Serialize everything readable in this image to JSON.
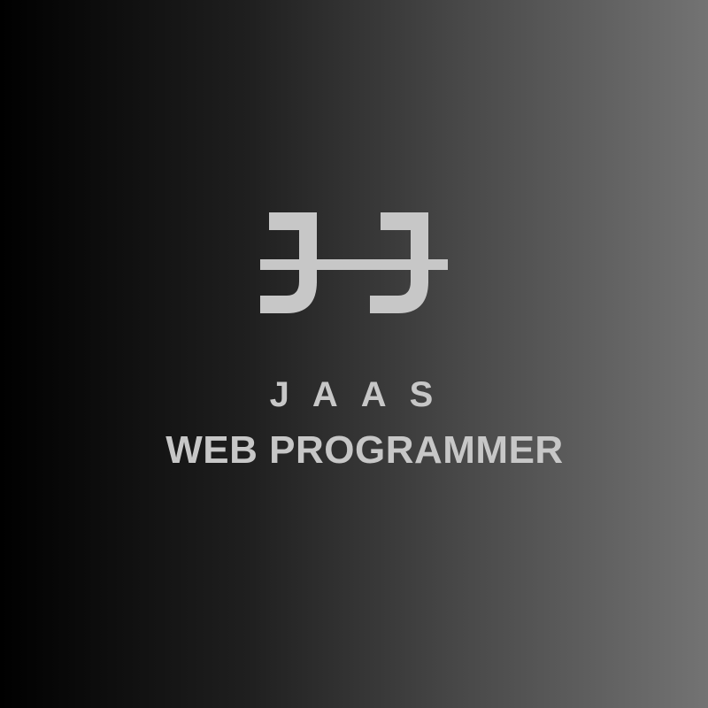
{
  "colors": {
    "background_left": "#000000",
    "background_right": "#737373",
    "logo_and_text": "#c7c7c7"
  },
  "logo": {
    "icon": "double-j-monogram-icon"
  },
  "brand": {
    "name": "JAAS",
    "tagline": "WEB PROGRAMMER"
  }
}
